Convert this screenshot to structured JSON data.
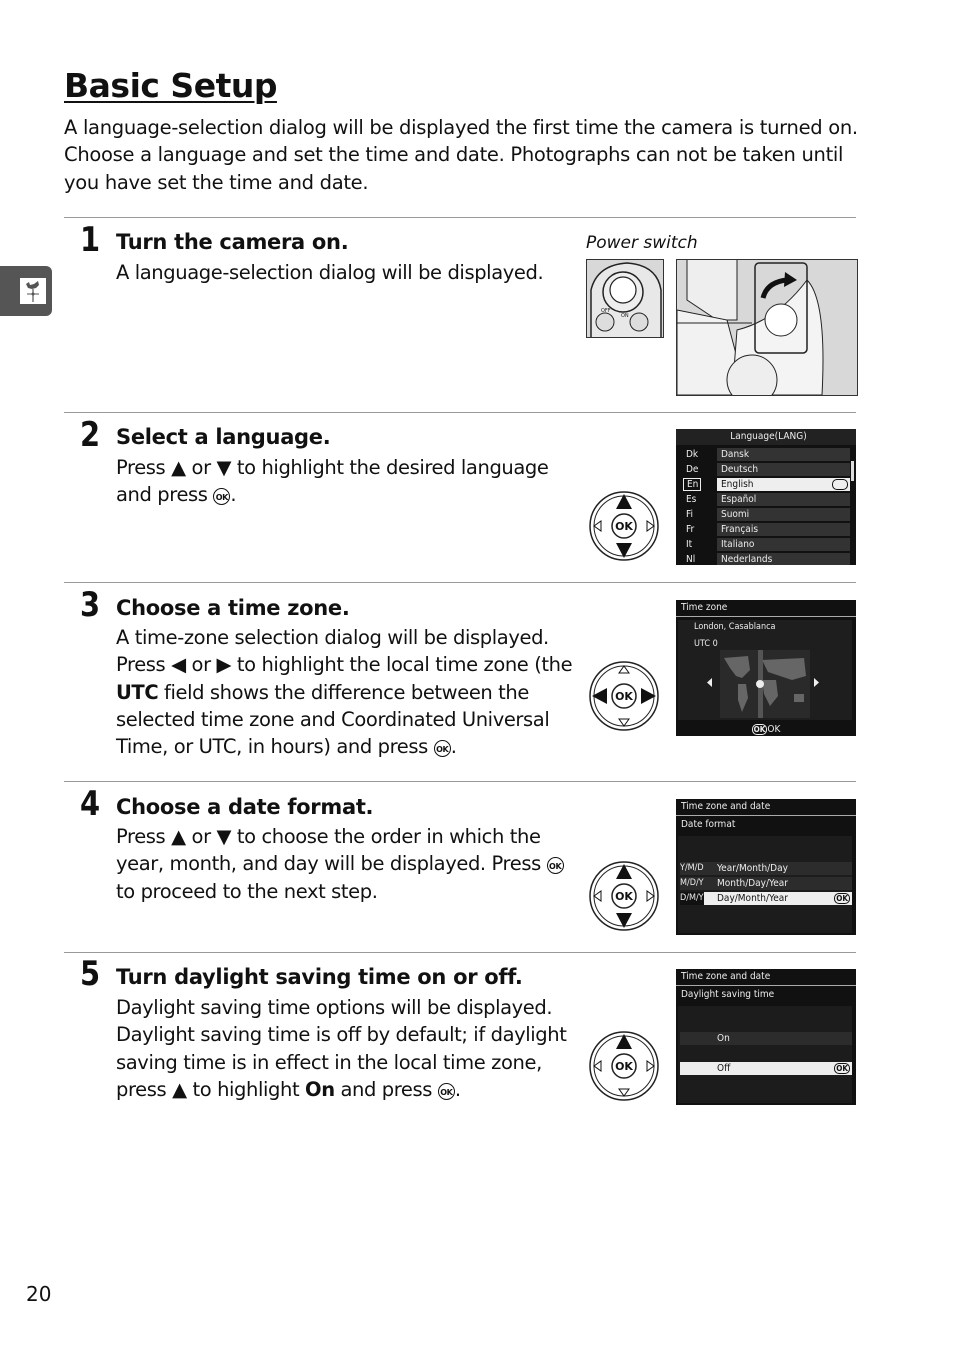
{
  "page": {
    "title": "Basic Setup",
    "intro": "A language-selection dialog will be displayed the first time the camera is turned on. Choose a language and set the time and date.  Photographs can not be taken until you have set the time and date.",
    "section_tab_icon": "weathercock-icon",
    "page_number": "20"
  },
  "steps": [
    {
      "number": "1",
      "title": "Turn the camera on.",
      "body": [
        "A language-selection dialog will be displayed."
      ],
      "figure_caption": "Power switch"
    },
    {
      "number": "2",
      "title": "Select a language.",
      "body": [
        "Press ",
        "▲",
        " or ",
        "▼",
        " to highlight the desired language and press ",
        "OK",
        "."
      ]
    },
    {
      "number": "3",
      "title": "Choose a time zone.",
      "body": [
        "A time-zone selection dialog will be displayed. Press ",
        "◀",
        " or ",
        "▶",
        " to highlight the local time zone (the ",
        "UTC",
        " field shows the difference between the selected time zone and Coordinated Universal Time, or UTC, in hours) and press ",
        "OK",
        "."
      ]
    },
    {
      "number": "4",
      "title": "Choose a date format.",
      "body": [
        "Press ",
        "▲",
        " or ",
        "▼",
        " to choose the order in which the year, month, and day will be displayed.  Press ",
        "OK",
        " to proceed to the next step."
      ]
    },
    {
      "number": "5",
      "title": "Turn daylight saving time on or off.",
      "body": [
        "Daylight saving time options will be displayed. Daylight saving time is off by default; if daylight saving time is in effect in the local time zone, press ",
        "▲",
        " to highlight ",
        "On",
        " and press ",
        "OK",
        "."
      ]
    }
  ],
  "screens": {
    "language": {
      "header": "Language(LANG)",
      "items": [
        {
          "code": "Dk",
          "name": "Dansk"
        },
        {
          "code": "De",
          "name": "Deutsch"
        },
        {
          "code": "En",
          "name": "English",
          "selected": true
        },
        {
          "code": "Es",
          "name": "Español"
        },
        {
          "code": "Fi",
          "name": "Suomi"
        },
        {
          "code": "Fr",
          "name": "Français"
        },
        {
          "code": "It",
          "name": "Italiano"
        },
        {
          "code": "Nl",
          "name": "Nederlands"
        }
      ],
      "ok_badge": "OK"
    },
    "timezone": {
      "header": "Time zone",
      "city": "London, Casablanca",
      "utc": "UTC  0",
      "footer_badge": "OK",
      "footer_label": "OK"
    },
    "dateformat": {
      "header": "Time zone and date",
      "subheader": "Date format",
      "items": [
        {
          "code": "Y/M/D",
          "name": "Year/Month/Day"
        },
        {
          "code": "M/D/Y",
          "name": "Month/Day/Year"
        },
        {
          "code": "D/M/Y",
          "name": "Day/Month/Year",
          "selected": true
        }
      ],
      "ok_badge": "OK"
    },
    "dst": {
      "header": "Time zone and date",
      "subheader": "Daylight saving time",
      "items": [
        {
          "name": "On"
        },
        {
          "name": "Off",
          "selected": true
        }
      ],
      "ok_badge": "OK"
    }
  },
  "dpad": {
    "center_label": "OK"
  }
}
